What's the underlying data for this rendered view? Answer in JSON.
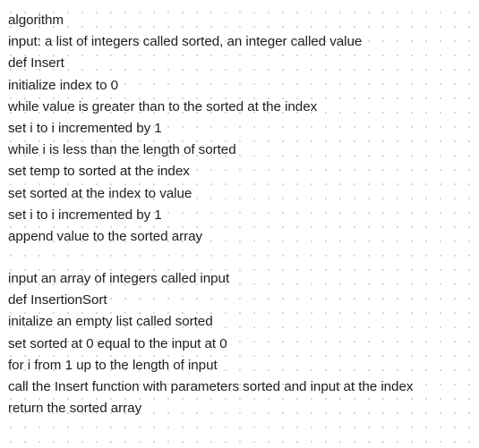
{
  "canvas": {
    "background": "#ffffff",
    "dot_color": "#d6d6d6",
    "text_color": "#1e1e1e"
  },
  "insert_block": [
    "algorithm",
    "input: a list of integers called sorted, an integer called value",
    "def Insert",
    "initialize index to 0",
    "while value is greater than to the sorted at the index",
    "set i to i incremented by 1",
    "while i is less than the length of sorted",
    "set temp to sorted at the index",
    "set sorted at the index to value",
    "set i to i incremented by 1",
    "append value to the sorted array"
  ],
  "insertion_sort_block": [
    "input an array of integers called input",
    "def InsertionSort",
    "initalize an empty list called sorted",
    "set sorted at 0 equal to the input at 0",
    "for i from 1 up to the length of input",
    "call the Insert function with parameters sorted and input at the index",
    "return the sorted array"
  ]
}
